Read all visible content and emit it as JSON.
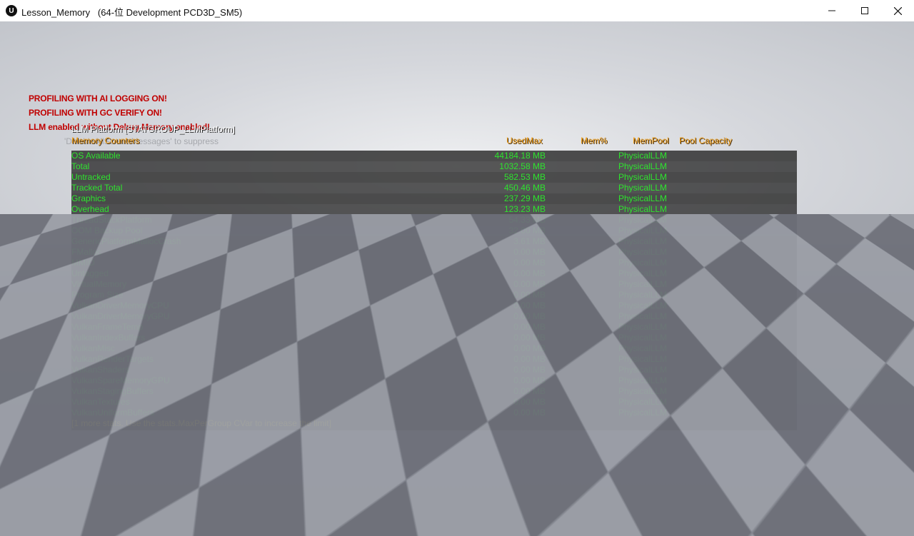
{
  "window": {
    "icon_text": "U",
    "title": "Lesson_Memory   (64-位 Development PCD3D_SM5)"
  },
  "warnings": [
    "PROFILING WITH AI LOGGING ON!",
    "PROFILING WITH GC VERIFY ON!",
    "LLM enabled without Debug Memory enabled!"
  ],
  "suppress_hint": "'DisableAllScreenMessages' to suppress",
  "stat_group": {
    "title": "LLM Platform [STATGROUP_LLMPlatform]",
    "headers": {
      "name": "Memory Counters",
      "used_max": "UsedMax",
      "mem_pct": "Mem%",
      "mem_pool": "MemPool",
      "pool_capacity": "Pool Capacity"
    },
    "rows": [
      {
        "name": "OS Available",
        "used": "44184.18 MB",
        "pool": "PhysicalLLM"
      },
      {
        "name": "Total",
        "used": "1032.58 MB",
        "pool": "PhysicalLLM"
      },
      {
        "name": "Untracked",
        "used": "582.53 MB",
        "pool": "PhysicalLLM"
      },
      {
        "name": "Tracked Total",
        "used": "450.46 MB",
        "pool": "PhysicalLLM"
      },
      {
        "name": "Graphics",
        "used": "237.29 MB",
        "pool": "PhysicalLLM"
      },
      {
        "name": "Overhead",
        "used": "123.23 MB",
        "pool": "PhysicalLLM"
      },
      {
        "name": "ThreadStackPlatform",
        "used": "54.33 MB",
        "pool": "PhysicalLLM"
      },
      {
        "name": "OOM Backup Pool",
        "used": "32.00 MB",
        "pool": "PhysicalLLM"
      },
      {
        "name": "GenericPlatformMallocCrash",
        "used": "3.61 MB",
        "pool": "PhysicalLLM"
      },
      {
        "name": "FMalloc",
        "used": "0.00 MB",
        "pool": "PhysicalLLM"
      },
      {
        "name": "MMIO",
        "used": "0.00 MB",
        "pool": "PhysicalLLM"
      },
      {
        "name": "Untagged",
        "used": "0.00 MB",
        "pool": "PhysicalLLM"
      },
      {
        "name": "VirtualMemory",
        "used": "0.00 MB",
        "pool": "PhysicalLLM"
      },
      {
        "name": "Program Size",
        "used": "0.00 MB",
        "pool": "PhysicalLLM"
      },
      {
        "name": "VulkanDriverMemoryCPU",
        "used": "0.00 MB",
        "pool": "PhysicalLLM"
      },
      {
        "name": "VulkanDriverMemoryGPU",
        "used": "0.00 MB",
        "pool": "PhysicalLLM"
      },
      {
        "name": "VulkanFrameTemp",
        "used": "0.00 MB",
        "pool": "PhysicalLLM"
      },
      {
        "name": "VulkanIndexBuffers",
        "used": "0.00 MB",
        "pool": "PhysicalLLM"
      },
      {
        "name": "VulkanMisc",
        "used": "0.00 MB",
        "pool": "PhysicalLLM"
      },
      {
        "name": "VulkanRenderTargets",
        "used": "0.00 MB",
        "pool": "PhysicalLLM"
      },
      {
        "name": "VulkanShaders",
        "used": "0.00 MB",
        "pool": "PhysicalLLM"
      },
      {
        "name": "VulkanSpareMemoryGPU",
        "used": "0.00 MB",
        "pool": "PhysicalLLM"
      },
      {
        "name": "VulkanStagingBuffers",
        "used": "0.00 MB",
        "pool": "PhysicalLLM"
      },
      {
        "name": "VulkanTextures",
        "used": "0.00 MB",
        "pool": "PhysicalLLM"
      },
      {
        "name": "VulkanUniformBuffers",
        "used": "0.00 MB",
        "pool": "PhysicalLLM"
      }
    ],
    "more_stats": "[1 more stats. Use the stats.MaxPerGroup CVar to increase the limit]"
  },
  "colors": {
    "warning": "#c00000",
    "header": "#f5a623",
    "stat_text": "#2ee32e",
    "more_text": "#f0e020"
  }
}
